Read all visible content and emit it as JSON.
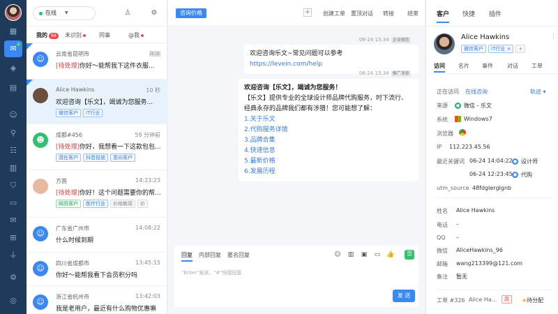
{
  "status": {
    "label": "在线"
  },
  "list_tabs": {
    "mine": "我的",
    "mine_count": "88",
    "unrecognized": "未识别",
    "colleague": "同事",
    "at_me": "@我"
  },
  "conversations": [
    {
      "name": "云南省昆明市",
      "time": "刚刚",
      "pending": "[待处理]",
      "msg": "你好～能帮我下这件衣服...",
      "tags": []
    },
    {
      "name": "Alice Hawkins",
      "time": "10 秒",
      "pending": "",
      "msg": "欢迎咨询【乐文】，竭诚为您服务...",
      "tags": [
        "微信客户",
        "IT行业"
      ]
    },
    {
      "name": "成都#456",
      "time": "59 分钟前",
      "pending": "[待处理]",
      "msg": "你好，我想看一下这款包包...",
      "tags": [
        "潜在客户",
        "抖音投放",
        "意向客户"
      ]
    },
    {
      "name": "方茜",
      "time": "14:23:23",
      "pending": "[待处理]",
      "msg": "你好！这个问题需要你的帮...",
      "tags": [
        "网页客户",
        "医疗行业",
        "价格敏感",
        "价"
      ]
    },
    {
      "name": "广东省广州市",
      "time": "14:08:22",
      "pending": "",
      "msg": "什么时候到期",
      "tags": []
    },
    {
      "name": "四川省成都市",
      "time": "13:45:15",
      "pending": "",
      "msg": "你好～能帮我看下会员积分吗",
      "tags": []
    },
    {
      "name": "浙江省杭州市",
      "time": "13:42:03",
      "pending": "",
      "msg": "我是老用户，最近有什么购物优惠嘛",
      "tags": []
    }
  ],
  "chat_header": {
    "tag": "咨询价格",
    "actions": [
      "创建工单",
      "置顶对话",
      "转接",
      "结束"
    ]
  },
  "messages": [
    {
      "meta": "06-24 15:34",
      "src": "企业微信",
      "text": "欢迎咨询乐文~常见问题可以参考 ",
      "link": "https://levein.com/help"
    },
    {
      "meta": "06-24 15:34",
      "src": "推广消息",
      "title": "欢迎咨询【乐文】，竭诚为您服务！",
      "body": "【乐文】提供专业的全球设计师品牌代购服务，时下流行、经典永存的品牌我们都有涉猎！您可能想了解：",
      "options": [
        "1.关于乐文",
        "2.代购服务详情",
        "3.品牌合集",
        "4.快速信息",
        "5.最新价格",
        "6.发展历程"
      ]
    }
  ],
  "editor": {
    "tabs": [
      "回复",
      "内部回复",
      "匿名回复"
    ],
    "placeholder": "\"Enter\"发送，\"#\"快捷回复",
    "send": "发 送"
  },
  "right_tabs": [
    "客户",
    "快捷",
    "插件"
  ],
  "profile": {
    "name": "Alice Hawkins",
    "tags": [
      "微信客户",
      "IT行业"
    ]
  },
  "sub_tabs": [
    "访问",
    "名片",
    "事件",
    "对话",
    "工单"
  ],
  "visit": {
    "visiting_label": "正在访问",
    "visiting_value": "在线咨询",
    "track": "轨迹",
    "source_label": "来源",
    "source_value": "微信 - 乐文",
    "system_label": "系统",
    "system_value": "Windows7",
    "browser_label": "浏览器",
    "ip_label": "IP",
    "ip_value": "112.223.45.56",
    "keyword_label": "最近关键词",
    "keywords": [
      {
        "time": "06-24 14:04:22",
        "word": "设计师"
      },
      {
        "time": "06-24 12:23:45",
        "word": "代购"
      }
    ],
    "utm_label": "utm_source",
    "utm_value": "48fdglergIgnb"
  },
  "card": [
    {
      "label": "姓名",
      "value": "Alice Hawkins"
    },
    {
      "label": "电话",
      "value": "–"
    },
    {
      "label": "QQ",
      "value": "–"
    },
    {
      "label": "微信",
      "value": "AliceHawkins_96"
    },
    {
      "label": "邮箱",
      "value": "wang213399@121.com"
    },
    {
      "label": "备注",
      "value": "暂无"
    }
  ],
  "ticket": {
    "label": "工单 #326",
    "name": "Alice Ha...",
    "priority": "高",
    "status": "待分配"
  }
}
